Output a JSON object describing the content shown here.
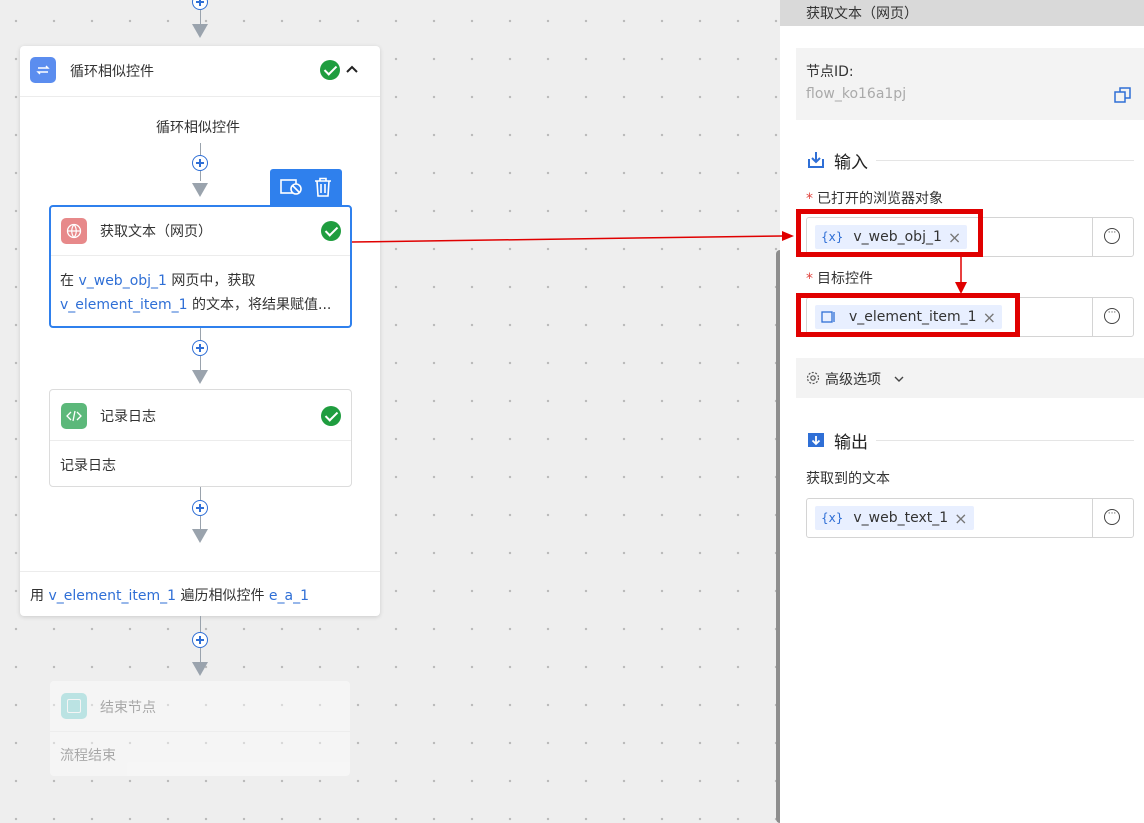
{
  "canvas": {
    "loop_node": {
      "title": "循环相似控件",
      "inner_label": "循环相似控件",
      "footer_prefix": "用",
      "footer_var": "v_element_item_1",
      "footer_mid": "遍历相似控件",
      "footer_target": "e_a_1"
    },
    "get_text_node": {
      "title": "获取文本（网页）",
      "desc_1": "在",
      "desc_var1": "v_web_obj_1",
      "desc_2": "网页中，获取",
      "desc_var2": "v_element_item_1",
      "desc_3": "的文本，将结果赋值..."
    },
    "log_node": {
      "title": "记录日志",
      "body": "记录日志"
    },
    "end_node": {
      "title": "结束节点",
      "body": "流程结束"
    },
    "toolbar": {
      "icons": [
        "disable-icon",
        "trash-icon"
      ]
    }
  },
  "panel": {
    "header_title": "获取文本（网页）",
    "node_id_label": "节点ID:",
    "node_id_value": "flow_ko16a1pj",
    "input_section": "输入",
    "browser_label": "已打开的浏览器对象",
    "browser_value": "v_web_obj_1",
    "target_label": "目标控件",
    "target_value": "v_element_item_1",
    "advanced_label": "高级选项",
    "output_section": "输出",
    "output_label": "获取到的文本",
    "output_value": "v_web_text_1",
    "var_icon_text": "{x}",
    "required_mark": "*"
  },
  "colors": {
    "accent": "#2f6fd6",
    "success": "#1f9d3f",
    "annotation": "#e00000"
  }
}
